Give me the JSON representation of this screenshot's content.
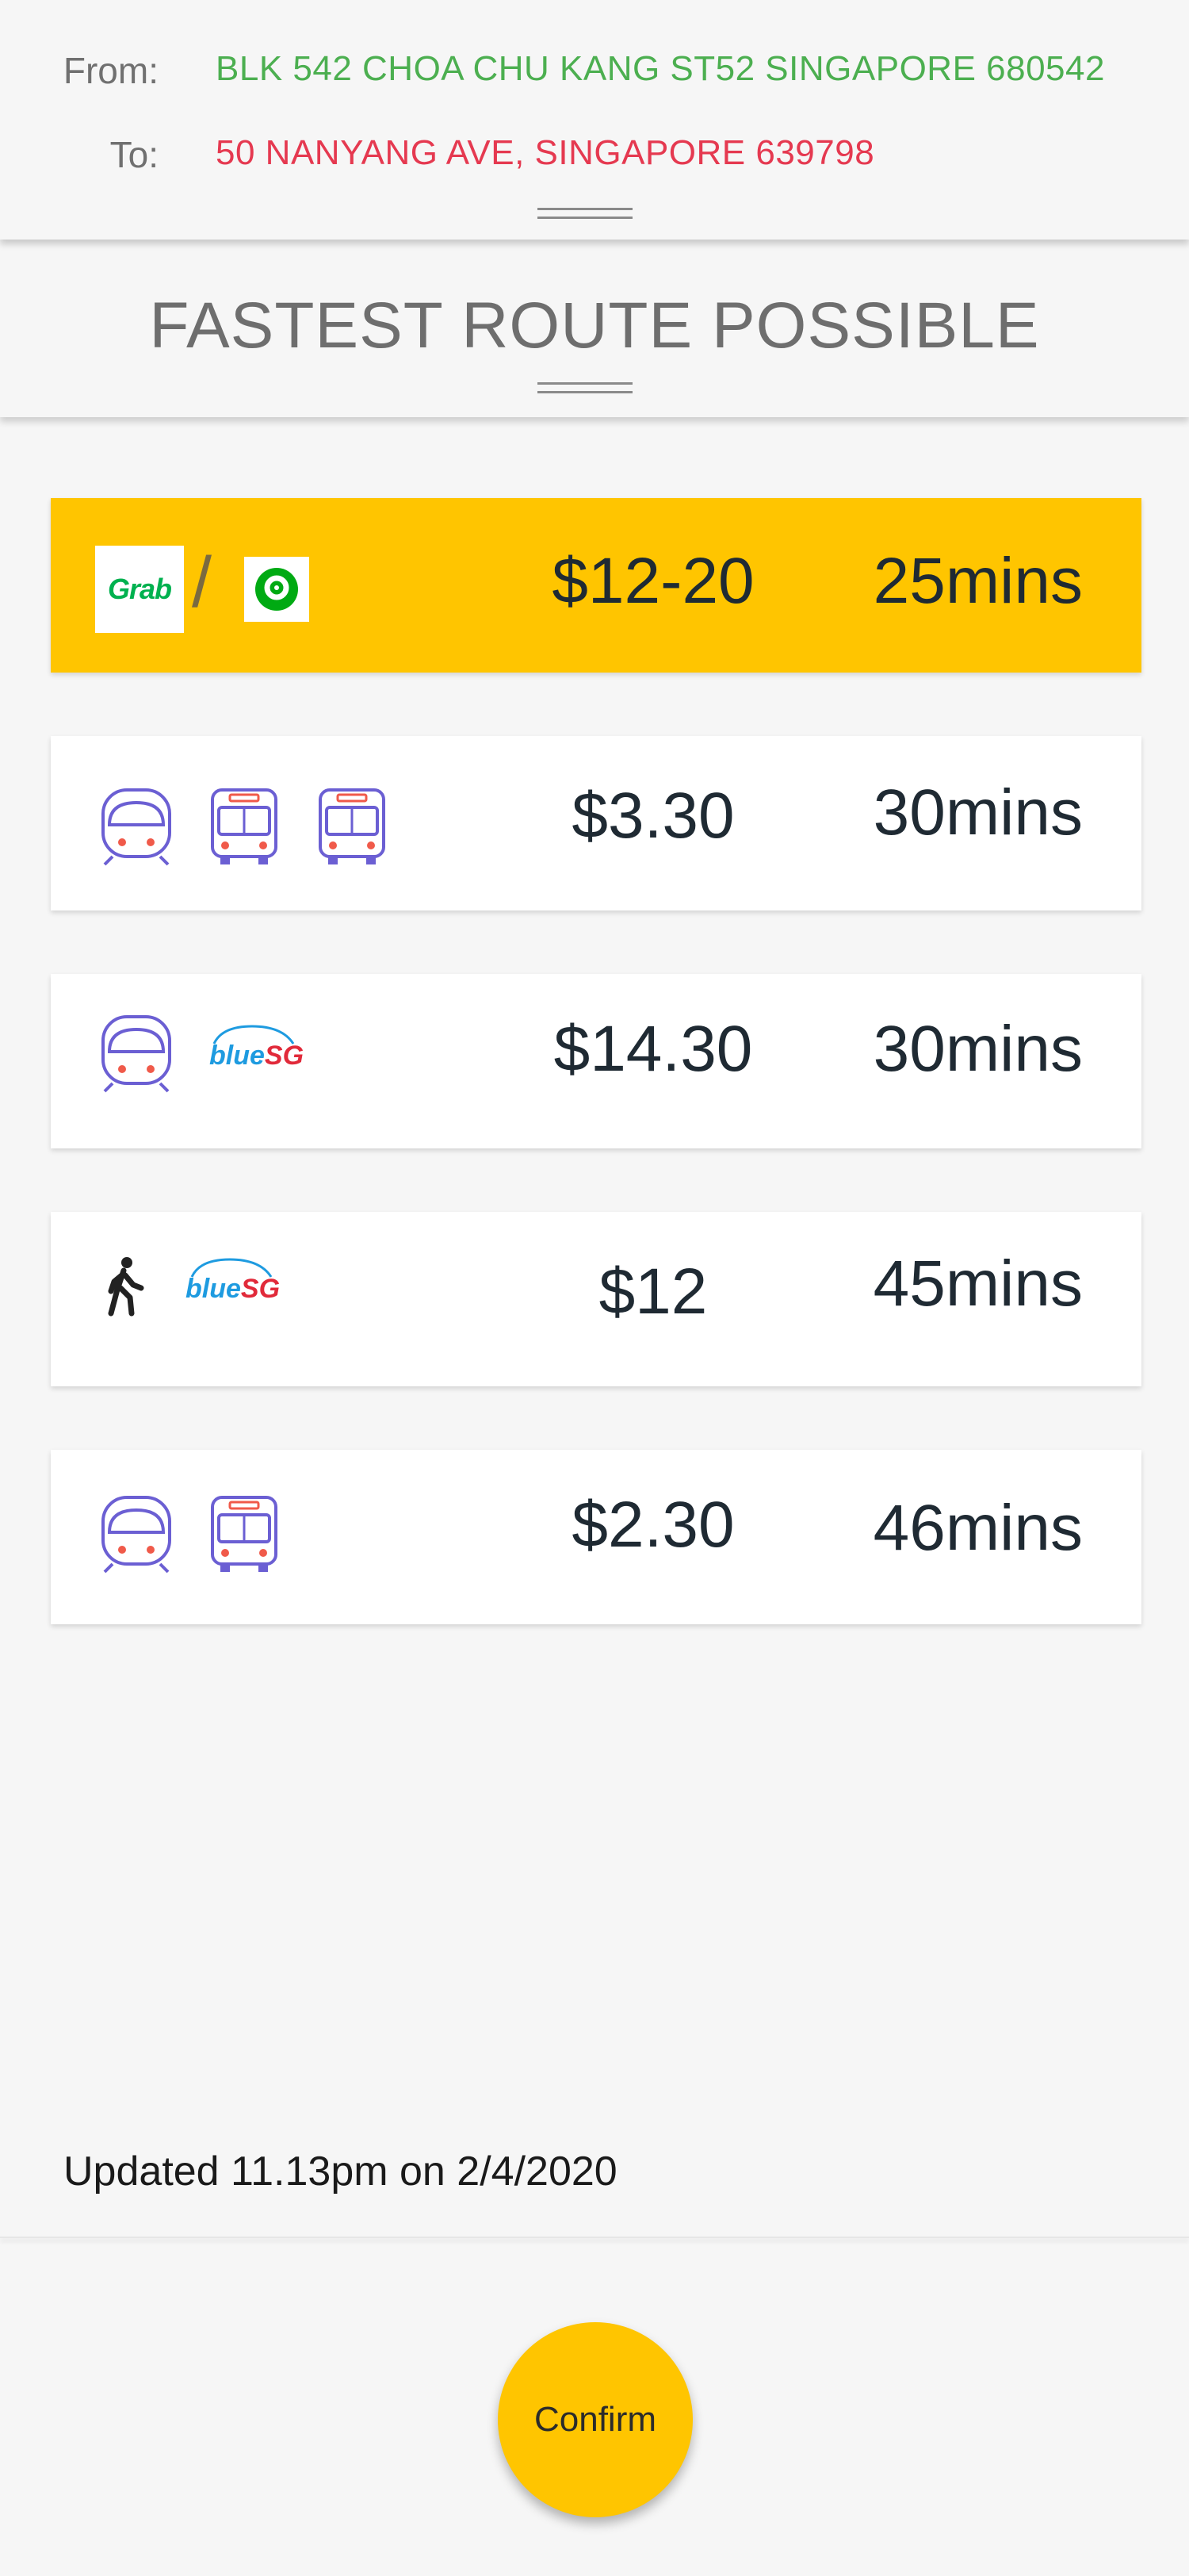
{
  "route": {
    "from_label": "From:",
    "from_value": "BLK 542 CHOA CHU KANG ST52 SINGAPORE 680542",
    "to_label": "To:",
    "to_value": "50 NANYANG AVE, SINGAPORE 639798"
  },
  "subheader": {
    "title": "FASTEST ROUTE POSSIBLE"
  },
  "options": [
    {
      "modes": [
        "grab-logo",
        "gojek-logo"
      ],
      "separator": "/",
      "price": "$12-20",
      "duration": "25mins",
      "selected": true
    },
    {
      "modes": [
        "train-icon",
        "bus-icon",
        "bus-icon"
      ],
      "price": "$3.30",
      "duration": "30mins",
      "selected": false
    },
    {
      "modes": [
        "train-icon",
        "bluesg-logo"
      ],
      "price": "$14.30",
      "duration": "30mins",
      "selected": false
    },
    {
      "modes": [
        "walk-icon",
        "bluesg-logo"
      ],
      "price": "$12",
      "duration": "45mins",
      "selected": false
    },
    {
      "modes": [
        "train-icon",
        "bus-icon"
      ],
      "price": "$2.30",
      "duration": "46mins",
      "selected": false
    }
  ],
  "logos": {
    "grab": "Grab",
    "bluesg_blue": "blue",
    "bluesg_sg": "SG"
  },
  "footer": {
    "updated": "Updated 11.13pm on 2/4/2020",
    "confirm_label": "Confirm"
  },
  "colors": {
    "from": "#4caf50",
    "to": "#e53950",
    "accent": "#ffc500",
    "transit_icon": "#6b5fd3",
    "transit_light": "#f05a4a"
  }
}
